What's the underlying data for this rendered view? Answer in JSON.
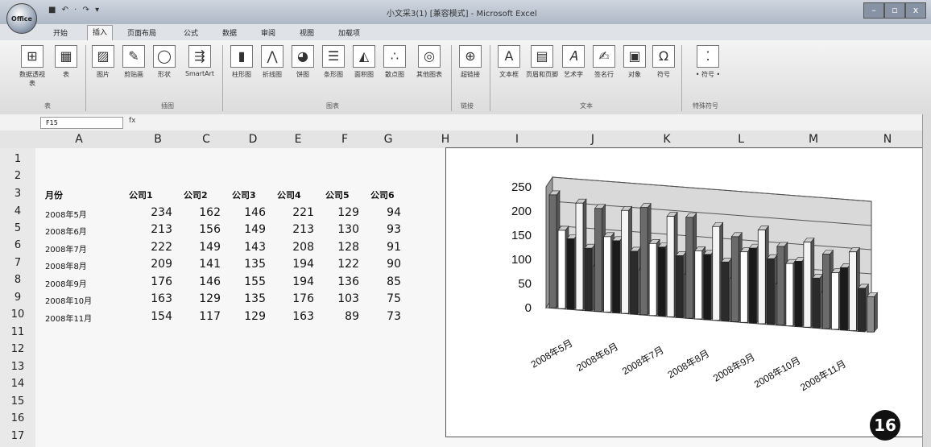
{
  "window": {
    "title": "小文采3(1) [兼容模式] - Microsoft Excel",
    "office_button": "Office",
    "qat": "■ ↶ · ↷ ▾",
    "controls": [
      "–",
      "▫",
      "x"
    ]
  },
  "ribbon": {
    "tabs": [
      "开始",
      "插入",
      "页面布局",
      "公式",
      "数据",
      "审阅",
      "视图",
      "加载项"
    ],
    "active_tab": 1,
    "buttons": [
      {
        "label": "数据透视表",
        "icon": "pivot-table-icon",
        "glyph": "⊞"
      },
      {
        "label": "表",
        "icon": "table-icon",
        "glyph": "▦"
      },
      {
        "label": "图片",
        "icon": "picture-icon",
        "glyph": "▨"
      },
      {
        "label": "剪贴画",
        "icon": "clip-art-icon",
        "glyph": "✎"
      },
      {
        "label": "形状",
        "icon": "shapes-icon",
        "glyph": "◯"
      },
      {
        "label": "SmartArt",
        "icon": "smartart-icon",
        "glyph": "⇶"
      },
      {
        "label": "柱形图",
        "icon": "column-chart-icon",
        "glyph": "▮"
      },
      {
        "label": "折线图",
        "icon": "line-chart-icon",
        "glyph": "⋀"
      },
      {
        "label": "饼图",
        "icon": "pie-chart-icon",
        "glyph": "◕"
      },
      {
        "label": "条形图",
        "icon": "bar-chart-icon",
        "glyph": "☰"
      },
      {
        "label": "面积图",
        "icon": "area-chart-icon",
        "glyph": "◭"
      },
      {
        "label": "散点图",
        "icon": "scatter-chart-icon",
        "glyph": "∴"
      },
      {
        "label": "其他图表",
        "icon": "other-charts-icon",
        "glyph": "◎"
      },
      {
        "label": "超链接",
        "icon": "hyperlink-icon",
        "glyph": "⊕"
      },
      {
        "label": "文本框",
        "icon": "text-box-icon",
        "glyph": "A"
      },
      {
        "label": "页眉和页脚",
        "icon": "header-footer-icon",
        "glyph": "▤"
      },
      {
        "label": "艺术字",
        "icon": "wordart-icon",
        "glyph": "𝐴"
      },
      {
        "label": "签名行",
        "icon": "signature-line-icon",
        "glyph": "✍"
      },
      {
        "label": "对象",
        "icon": "object-icon",
        "glyph": "▣"
      },
      {
        "label": "符号",
        "icon": "symbol-icon",
        "glyph": "Ω"
      },
      {
        "label": "• 符号 •",
        "icon": "special-symbols-icon",
        "glyph": "⁚"
      }
    ],
    "groups": [
      "表",
      "插图",
      "图表",
      "链接",
      "文本",
      "特殊符号"
    ]
  },
  "formula_bar": {
    "name_box": "F15",
    "fx": "fx"
  },
  "columns": [
    "A",
    "B",
    "C",
    "D",
    "E",
    "F",
    "G",
    "H",
    "I",
    "J",
    "K",
    "L",
    "M",
    "N"
  ],
  "rows": [
    "1",
    "2",
    "3",
    "4",
    "5",
    "6",
    "7",
    "8",
    "9",
    "10",
    "11",
    "12",
    "13",
    "14",
    "15",
    "16",
    "17"
  ],
  "table": {
    "header": [
      "月份",
      "公司1",
      "公司2",
      "公司3",
      "公司4",
      "公司5",
      "公司6"
    ],
    "rows": [
      {
        "month": "2008年5月",
        "values": [
          "234",
          "162",
          "146",
          "221",
          "129",
          "94"
        ]
      },
      {
        "month": "2008年6月",
        "values": [
          "213",
          "156",
          "149",
          "213",
          "130",
          "93"
        ]
      },
      {
        "month": "2008年7月",
        "values": [
          "222",
          "149",
          "143",
          "208",
          "128",
          "91"
        ]
      },
      {
        "month": "2008年8月",
        "values": [
          "209",
          "141",
          "135",
          "194",
          "122",
          "90"
        ]
      },
      {
        "month": "2008年9月",
        "values": [
          "176",
          "146",
          "155",
          "194",
          "136",
          "85"
        ]
      },
      {
        "month": "2008年10月",
        "values": [
          "163",
          "129",
          "135",
          "176",
          "103",
          "75"
        ]
      },
      {
        "month": "2008年11月",
        "values": [
          "154",
          "117",
          "129",
          "163",
          "89",
          "73"
        ]
      }
    ]
  },
  "badge": "16",
  "chart_data": {
    "type": "bar",
    "categories": [
      "2008年5月",
      "2008年6月",
      "2008年7月",
      "2008年8月",
      "2008年9月",
      "2008年10月",
      "2008年11月"
    ],
    "series": [
      {
        "values": [
          234,
          213,
          222,
          209,
          176,
          163,
          154
        ],
        "color": "#6b6b6b"
      },
      {
        "values": [
          162,
          156,
          149,
          141,
          146,
          129,
          117
        ],
        "color": "#ffffff"
      },
      {
        "values": [
          146,
          149,
          143,
          135,
          155,
          135,
          129
        ],
        "color": "#1a1a1a"
      },
      {
        "values": [
          221,
          213,
          208,
          194,
          194,
          176,
          163
        ],
        "color": "#f4f4f4"
      },
      {
        "values": [
          129,
          130,
          128,
          122,
          136,
          103,
          89
        ],
        "color": "#2b2b2b"
      },
      {
        "values": [
          94,
          93,
          91,
          90,
          85,
          75,
          73
        ],
        "color": "#8a8a8a"
      }
    ],
    "yticks": [
      "250",
      "200",
      "150",
      "100",
      "50",
      "0"
    ],
    "ylim": [
      0,
      250
    ],
    "legend": "none",
    "grid": true,
    "style": "3d-column"
  }
}
